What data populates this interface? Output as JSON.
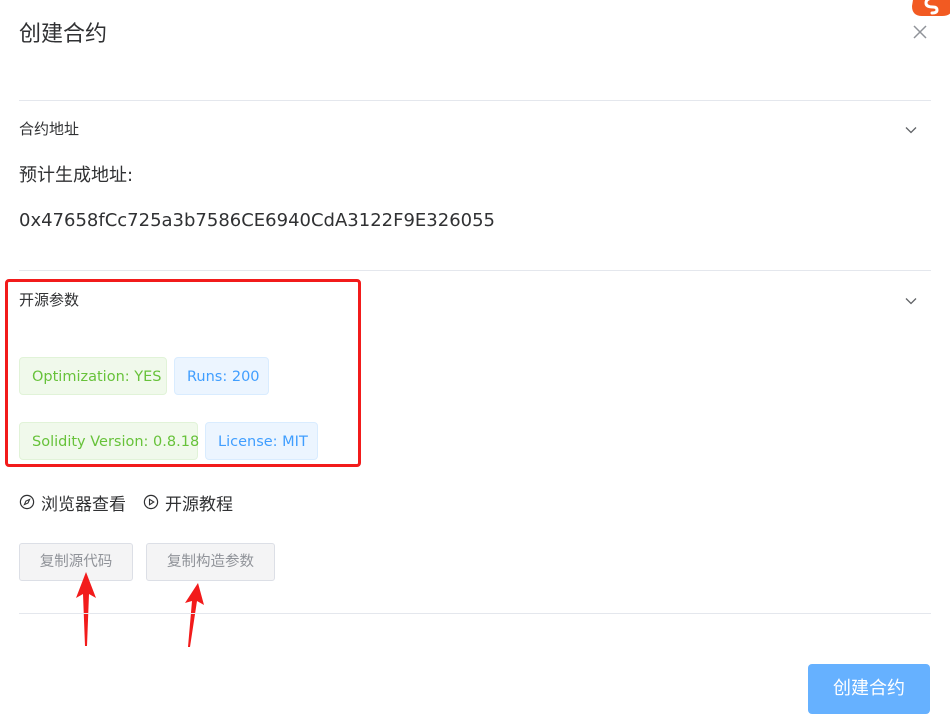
{
  "dialog": {
    "title": "创建合约",
    "close_icon": "close-icon"
  },
  "address_section": {
    "title": "合约地址",
    "label": "预计生成地址:",
    "address": "0x47658fCc725a3b7586CE6940CdA3122F9E326055"
  },
  "opensource_section": {
    "title": "开源参数",
    "tags": [
      {
        "label": "Optimization: YES",
        "type": "success"
      },
      {
        "label": "Runs: 200",
        "type": "info"
      },
      {
        "label": "Solidity Version: 0.8.18",
        "type": "success"
      },
      {
        "label": "License: MIT",
        "type": "info"
      }
    ]
  },
  "links": {
    "explorer": {
      "label": "浏览器查看",
      "icon": "compass-icon"
    },
    "tutorial": {
      "label": "开源教程",
      "icon": "play-circle-icon"
    }
  },
  "buttons": {
    "copy_source": "复制源代码",
    "copy_constructor": "复制构造参数",
    "create": "创建合约"
  },
  "colors": {
    "primary_button": "#66b1ff",
    "success_tag_text": "#67c23a",
    "info_tag_text": "#409eff",
    "annotation_red": "#f21b1b"
  }
}
